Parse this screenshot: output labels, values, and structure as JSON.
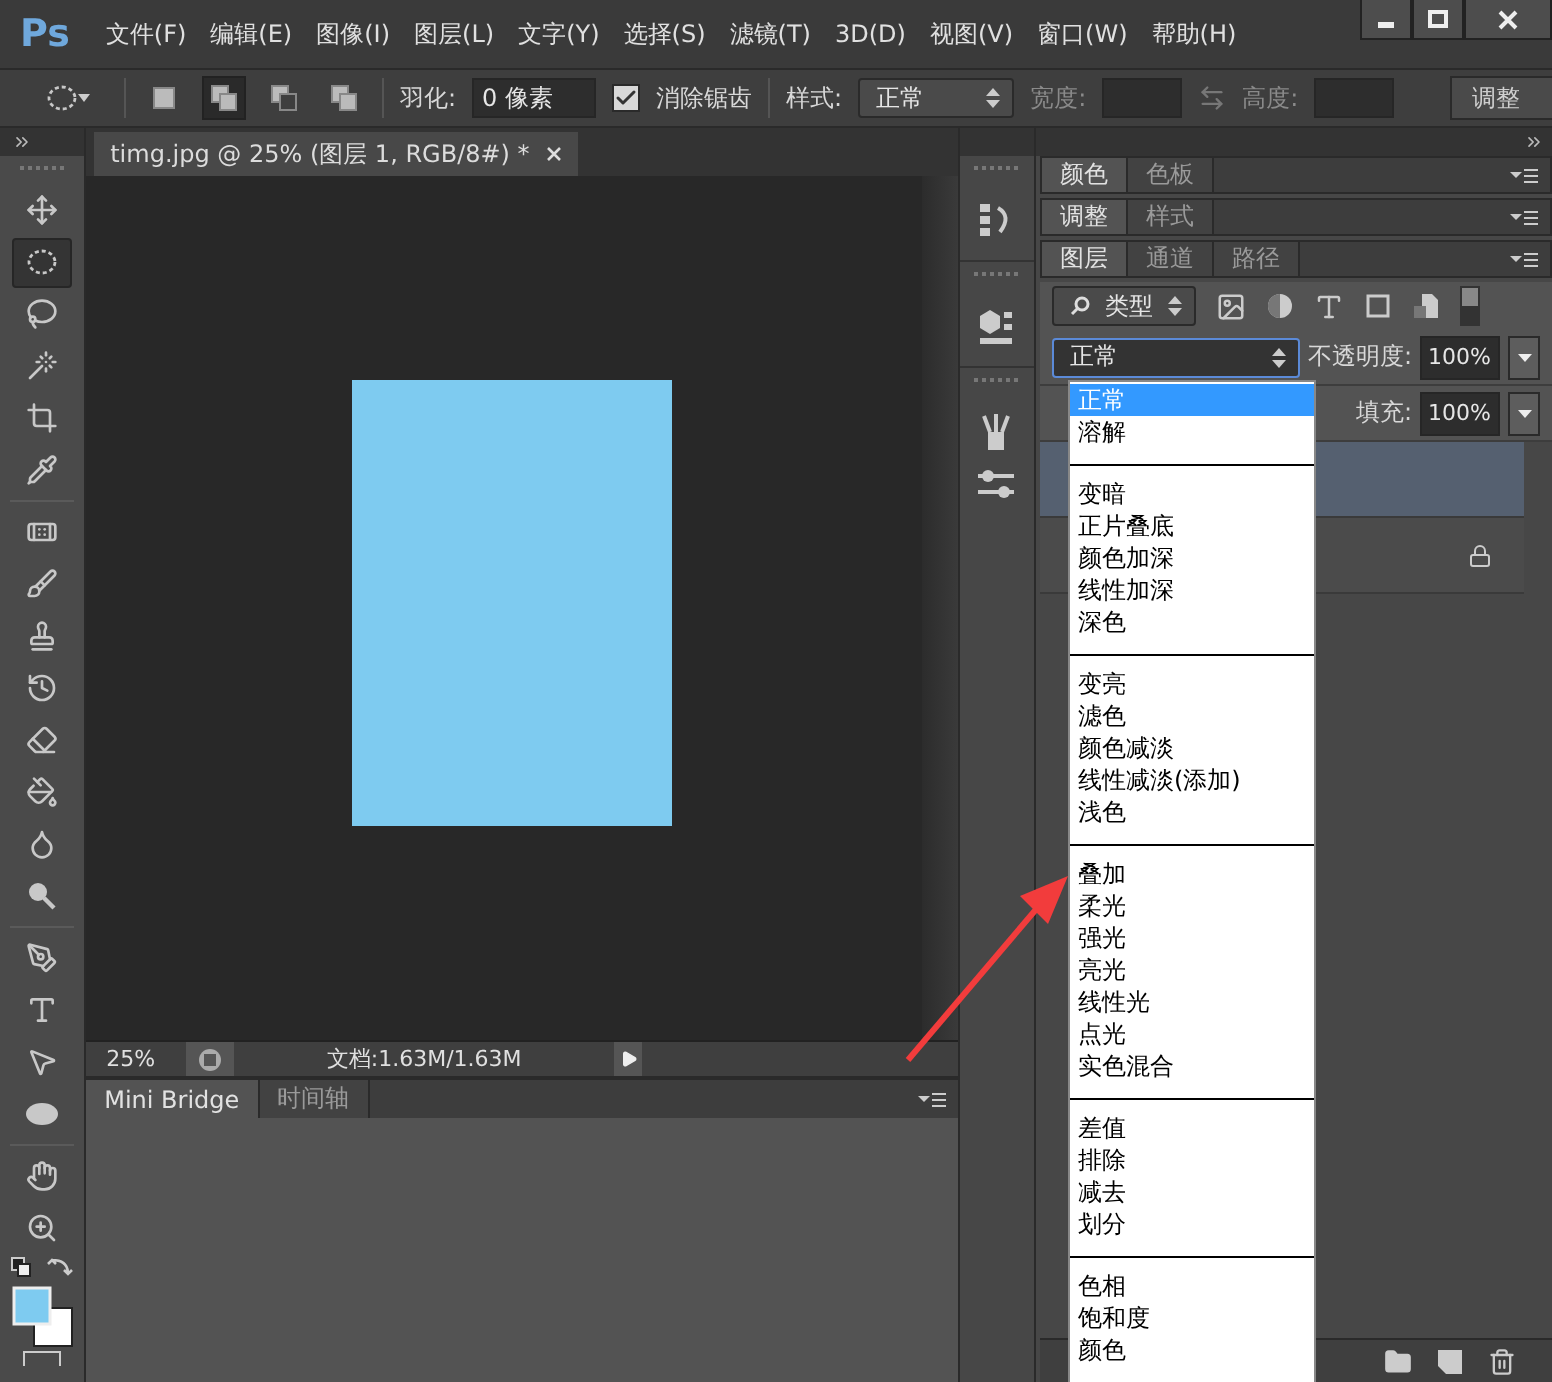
{
  "menu_bar": {
    "logo": "Ps",
    "items": [
      "文件(F)",
      "编辑(E)",
      "图像(I)",
      "图层(L)",
      "文字(Y)",
      "选择(S)",
      "滤镜(T)",
      "3D(D)",
      "视图(V)",
      "窗口(W)",
      "帮助(H)"
    ]
  },
  "options_bar": {
    "selection_modes": [
      {
        "selected": false
      },
      {
        "selected": true
      },
      {
        "selected": false
      },
      {
        "selected": false
      }
    ],
    "feather_label": "羽化:",
    "feather_value": "0 像素",
    "anti_alias": {
      "label": "消除锯齿",
      "checked": true
    },
    "style_label": "样式:",
    "style_value": "正常",
    "width_label": "宽度:",
    "height_label": "高度:",
    "refine_button": "调整"
  },
  "tool_groups": [
    {
      "tools": [
        {
          "kind": "move",
          "selected": false
        },
        {
          "kind": "marquee",
          "selected": true
        },
        {
          "kind": "lasso",
          "selected": false
        },
        {
          "kind": "wand",
          "selected": false
        },
        {
          "kind": "crop",
          "selected": false
        },
        {
          "kind": "eyedropper",
          "selected": false
        }
      ]
    },
    {
      "tools": [
        {
          "kind": "healing",
          "selected": false
        },
        {
          "kind": "brush",
          "selected": false
        },
        {
          "kind": "stamp",
          "selected": false
        },
        {
          "kind": "history",
          "selected": false
        },
        {
          "kind": "eraser",
          "selected": false
        },
        {
          "kind": "bucket",
          "selected": false
        },
        {
          "kind": "blur",
          "selected": false
        },
        {
          "kind": "dodge",
          "selected": false
        }
      ]
    },
    {
      "tools": [
        {
          "kind": "pen",
          "selected": false
        },
        {
          "kind": "type",
          "selected": false
        },
        {
          "kind": "path_select",
          "selected": false
        },
        {
          "kind": "shape",
          "selected": false
        }
      ]
    },
    {
      "tools": [
        {
          "kind": "hand",
          "selected": false
        },
        {
          "kind": "zoom",
          "selected": false
        }
      ]
    }
  ],
  "document": {
    "tab_title": "timg.jpg @ 25% (图层 1, RGB/8#) *",
    "zoom": "25%",
    "doc_info": "文档:1.63M/1.63M"
  },
  "bottom_panel": {
    "tabs": [
      {
        "label": "Mini Bridge",
        "selected": true
      },
      {
        "label": "时间轴",
        "selected": false
      }
    ]
  },
  "panels": [
    {
      "tabs": [
        {
          "label": "颜色",
          "selected": true
        },
        {
          "label": "色板",
          "selected": false
        }
      ]
    },
    {
      "tabs": [
        {
          "label": "调整",
          "selected": true
        },
        {
          "label": "样式",
          "selected": false
        }
      ]
    },
    {
      "tabs": [
        {
          "label": "图层",
          "selected": true
        },
        {
          "label": "通道",
          "selected": false
        },
        {
          "label": "路径",
          "selected": false
        }
      ]
    }
  ],
  "layers": {
    "filter_label": "类型",
    "blend_mode": "正常",
    "opacity_label": "不透明度:",
    "opacity": "100%",
    "fill_label": "填充:",
    "fill": "100%",
    "rows": [
      {
        "selected": true,
        "locked": false
      },
      {
        "selected": false,
        "locked": true
      }
    ]
  },
  "blend_menu": {
    "groups": [
      {
        "items": [
          {
            "label": "正常",
            "selected": true
          },
          {
            "label": "溶解",
            "selected": false
          }
        ]
      },
      {
        "items": [
          {
            "label": "变暗",
            "selected": false
          },
          {
            "label": "正片叠底",
            "selected": false
          },
          {
            "label": "颜色加深",
            "selected": false
          },
          {
            "label": "线性加深",
            "selected": false
          },
          {
            "label": "深色",
            "selected": false
          }
        ]
      },
      {
        "items": [
          {
            "label": "变亮",
            "selected": false
          },
          {
            "label": "滤色",
            "selected": false
          },
          {
            "label": "颜色减淡",
            "selected": false
          },
          {
            "label": "线性减淡(添加)",
            "selected": false
          },
          {
            "label": "浅色",
            "selected": false
          }
        ]
      },
      {
        "items": [
          {
            "label": "叠加",
            "selected": false
          },
          {
            "label": "柔光",
            "selected": false
          },
          {
            "label": "强光",
            "selected": false
          },
          {
            "label": "亮光",
            "selected": false
          },
          {
            "label": "线性光",
            "selected": false
          },
          {
            "label": "点光",
            "selected": false
          },
          {
            "label": "实色混合",
            "selected": false
          }
        ]
      },
      {
        "items": [
          {
            "label": "差值",
            "selected": false
          },
          {
            "label": "排除",
            "selected": false
          },
          {
            "label": "减去",
            "selected": false
          },
          {
            "label": "划分",
            "selected": false
          }
        ]
      },
      {
        "items": [
          {
            "label": "色相",
            "selected": false
          },
          {
            "label": "饱和度",
            "selected": false
          },
          {
            "label": "颜色",
            "selected": false
          }
        ]
      }
    ]
  }
}
